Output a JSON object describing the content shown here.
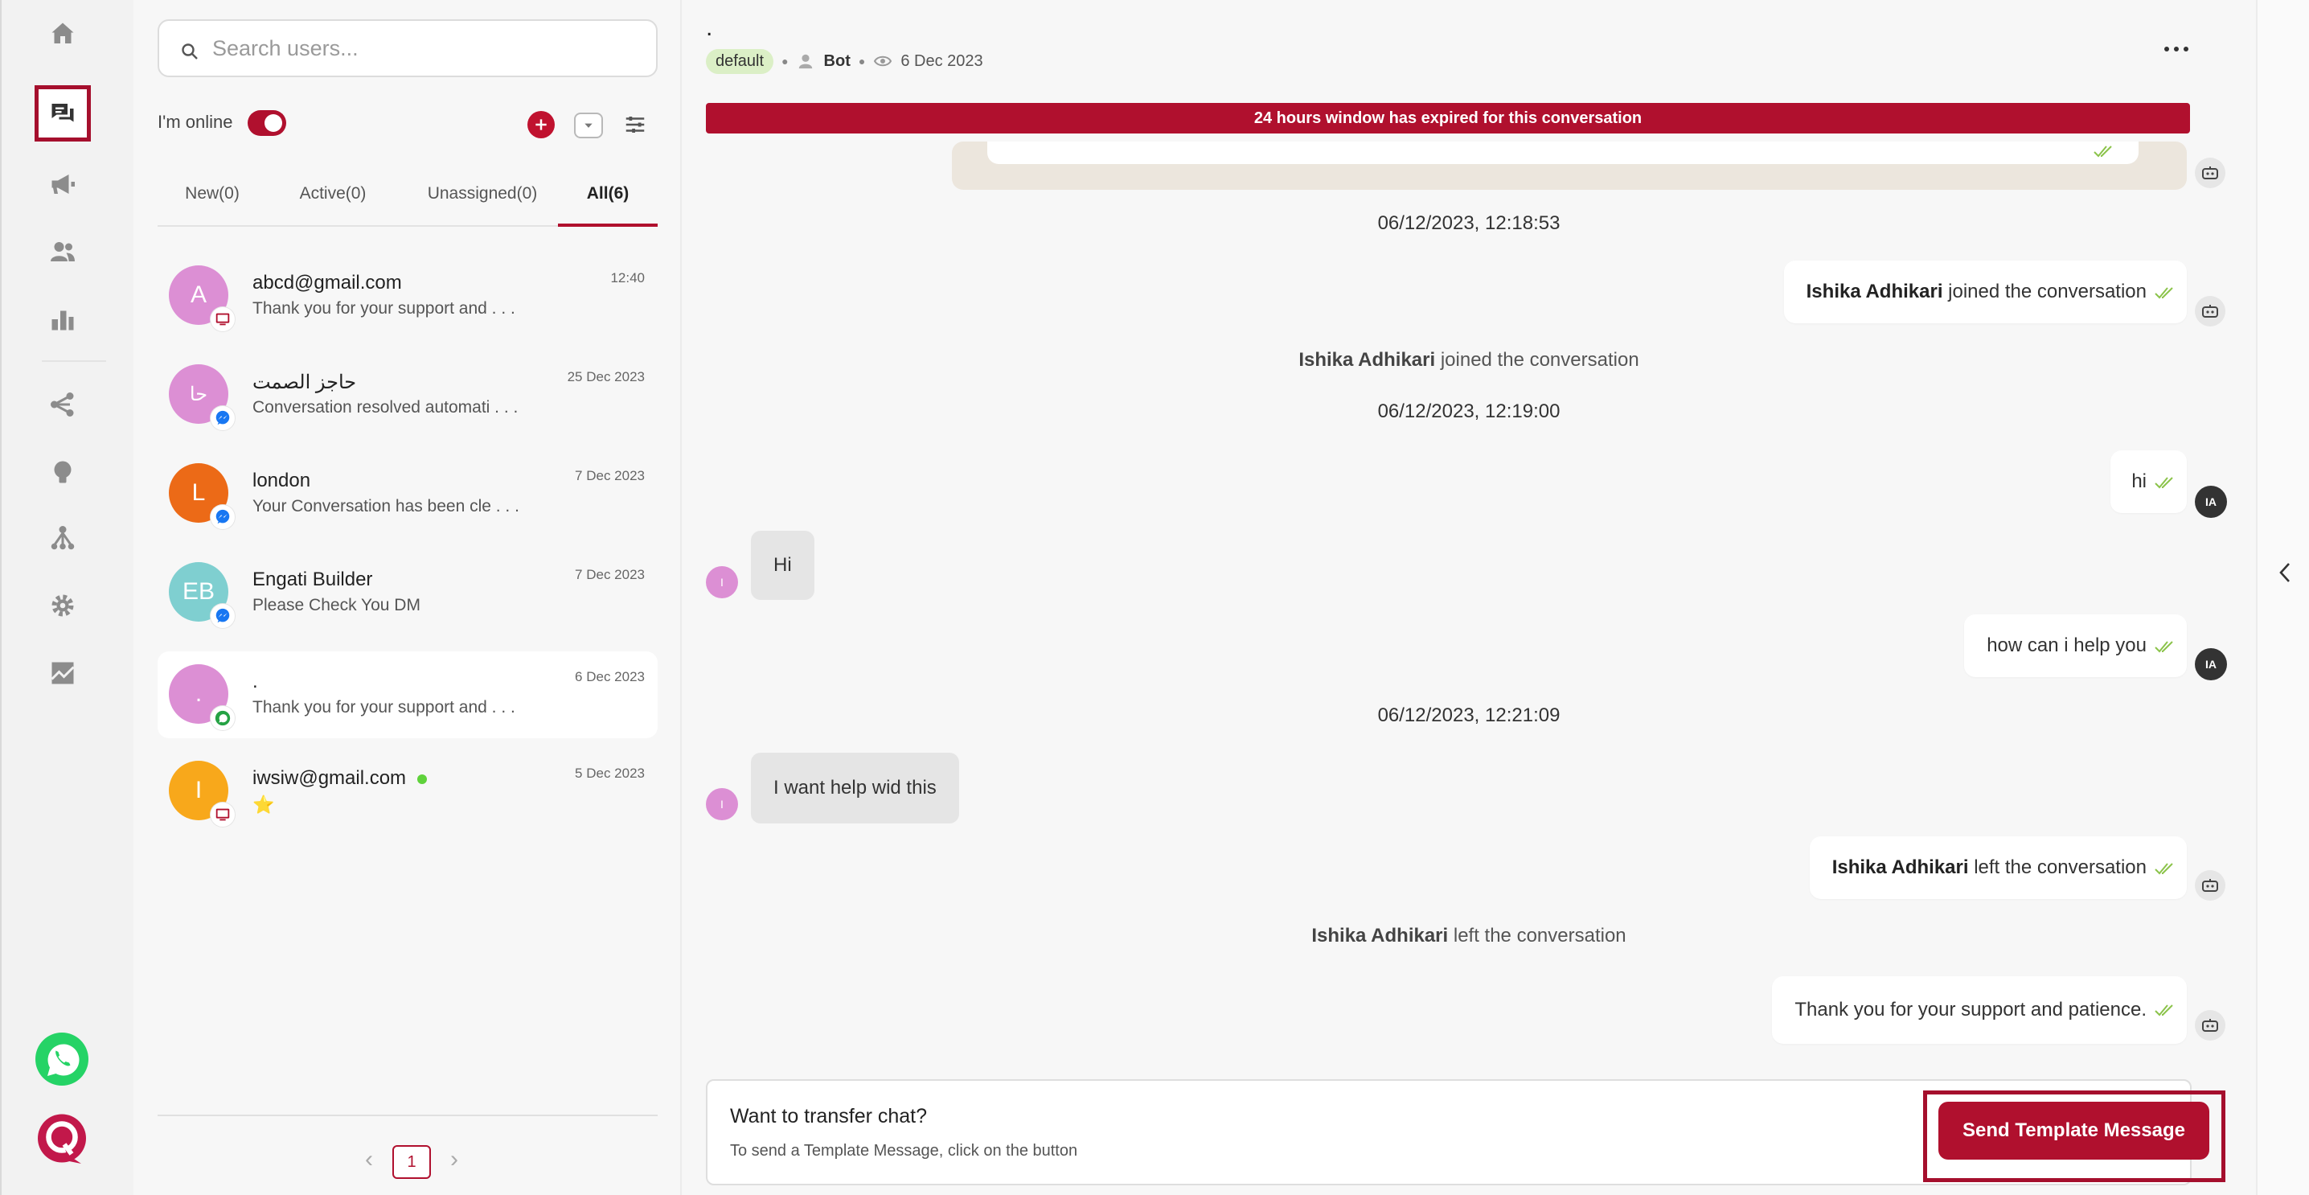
{
  "rail": {
    "items": [
      "home",
      "conversations",
      "broadcast",
      "users",
      "analytics",
      "flows",
      "ideas",
      "hierarchy",
      "settings",
      "integrations",
      "whatsapp",
      "brand"
    ]
  },
  "list": {
    "search_placeholder": "Search users...",
    "online_label": "I'm online",
    "online": true,
    "tabs": [
      {
        "label": "New(0)"
      },
      {
        "label": "Active(0)"
      },
      {
        "label": "Unassigned(0)"
      },
      {
        "label": "All(6)",
        "active": true
      }
    ],
    "conversations": [
      {
        "initials": "A",
        "name": "abcd@gmail.com",
        "preview": "Thank you for your support and . . .",
        "time": "12:40",
        "avatar_color": "#dc8fd4",
        "channel": "web"
      },
      {
        "initials": "حا",
        "name": "حاجز الصمت",
        "preview": "Conversation resolved automati . . .",
        "time": "25 Dec 2023",
        "avatar_color": "#dc8fd4",
        "channel": "messenger"
      },
      {
        "initials": "L",
        "name": "london",
        "preview": "Your Conversation has been cle . . .",
        "time": "7 Dec 2023",
        "avatar_color": "#ec6a17",
        "channel": "messenger"
      },
      {
        "initials": "EB",
        "name": "Engati Builder",
        "preview": "Please Check You DM",
        "time": "7 Dec 2023",
        "avatar_color": "#7fcfd0",
        "channel": "messenger"
      },
      {
        "initials": ".",
        "name": ".",
        "preview": "Thank you for your support and . . .",
        "time": "6 Dec 2023",
        "avatar_color": "#dc8fd4",
        "channel": "whatsapp",
        "selected": true
      },
      {
        "initials": "I",
        "name": "iwsiw@gmail.com",
        "preview": "⭐",
        "time": "5 Dec 2023",
        "avatar_color": "#f8a81b",
        "channel": "web",
        "online": true
      }
    ],
    "pager": {
      "prev": "‹",
      "current": "1",
      "next": "›"
    }
  },
  "chat": {
    "title": ".",
    "tag": "default",
    "agent": "Bot",
    "date": "6 Dec 2023",
    "banner": "24 hours window has expired for this conversation",
    "messages": {
      "ts1": "06/12/2023, 12:18:53",
      "joined_name": "Ishika Adhikari",
      "joined_text": "joined the conversation",
      "ts2": "06/12/2023, 12:19:00",
      "hi": "hi",
      "in_hi": "Hi",
      "help": "how can i help you",
      "ts3": "06/12/2023, 12:21:09",
      "in_help": "I want help wid this",
      "left_name": "Ishika Adhikari",
      "left_text": "left the conversation",
      "thanks": "Thank you for your support and patience.",
      "agent_initials": "IA",
      "user_initial": "I"
    },
    "composer": {
      "title": "Want to transfer chat?",
      "subtitle": "To send a Template Message, click on the button",
      "button": "Send Template Message"
    }
  },
  "colors": {
    "brand": "#b0102e",
    "check": "#8bc34a",
    "whatsapp": "#25d366",
    "messenger": "#1877f2"
  }
}
